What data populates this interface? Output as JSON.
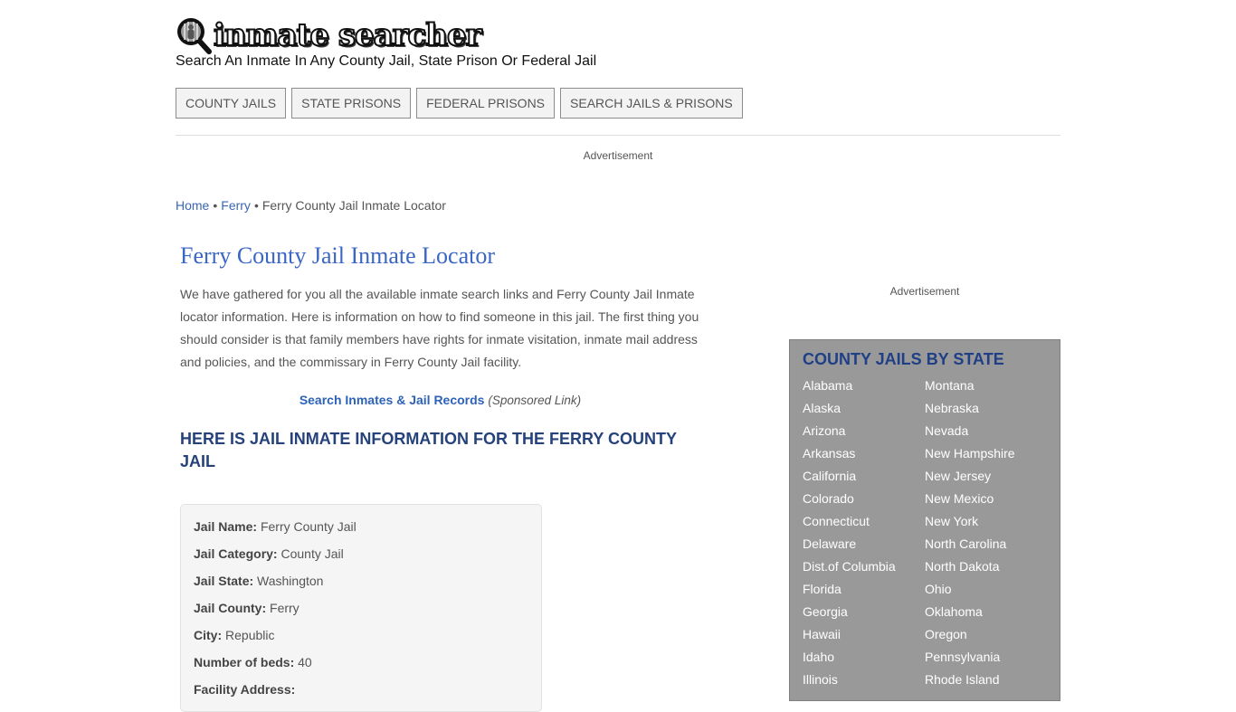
{
  "site": {
    "logo_text": "inmate searcher",
    "logo_icon": "magnifier-inmate-icon",
    "tagline": "Search An Inmate In Any County Jail, State Prison Or Federal Jail"
  },
  "nav": [
    {
      "label": "COUNTY JAILS"
    },
    {
      "label": "STATE PRISONS"
    },
    {
      "label": "FEDERAL PRISONS"
    },
    {
      "label": "SEARCH JAILS & PRISONS"
    }
  ],
  "ads": {
    "top": "Advertisement",
    "side": "Advertisement"
  },
  "breadcrumb": {
    "items": [
      {
        "label": "Home"
      },
      {
        "label": "Ferry"
      }
    ],
    "separator": "•",
    "current": "Ferry County Jail Inmate Locator"
  },
  "main": {
    "title": "Ferry County Jail Inmate Locator",
    "intro": "We have gathered for you all the available inmate search links and Ferry County Jail Inmate locator information. Here is information on how to find someone in this jail. The first thing you should consider is that family members have rights for inmate visitation, inmate mail address and policies, and the commissary in Ferry County Jail facility.",
    "sponsored_link": "Search Inmates & Jail Records",
    "sponsored_note": "(Sponsored Link)",
    "section_title": "HERE IS JAIL INMATE INFORMATION FOR THE FERRY COUNTY JAIL",
    "info": [
      {
        "label": "Jail Name:",
        "value": "Ferry County Jail"
      },
      {
        "label": "Jail Category:",
        "value": "County Jail"
      },
      {
        "label": "Jail State:",
        "value": "Washington"
      },
      {
        "label": "Jail County:",
        "value": "Ferry"
      },
      {
        "label": "City:",
        "value": "Republic"
      },
      {
        "label": "Number of beds:",
        "value": "40"
      },
      {
        "label": "Facility Address:",
        "value": ""
      }
    ]
  },
  "sidebar": {
    "title": "COUNTY JAILS BY STATE",
    "left": [
      "Alabama",
      "Alaska",
      "Arizona",
      "Arkansas",
      "California",
      "Colorado",
      "Connecticut",
      "Delaware",
      "Dist.of Columbia",
      "Florida",
      "Georgia",
      "Hawaii",
      "Idaho",
      "Illinois"
    ],
    "right": [
      "Montana",
      "Nebraska",
      "Nevada",
      "New Hampshire",
      "New Jersey",
      "New Mexico",
      "New York",
      "North Carolina",
      "North Dakota",
      "Ohio",
      "Oklahoma",
      "Oregon",
      "Pennsylvania",
      "Rhode Island"
    ]
  },
  "colors": {
    "link": "#3a66b5",
    "title": "#3a66c4",
    "section_title": "#25427a",
    "sidebar_bg": "#999999",
    "sidebar_title": "#1f3f86"
  }
}
